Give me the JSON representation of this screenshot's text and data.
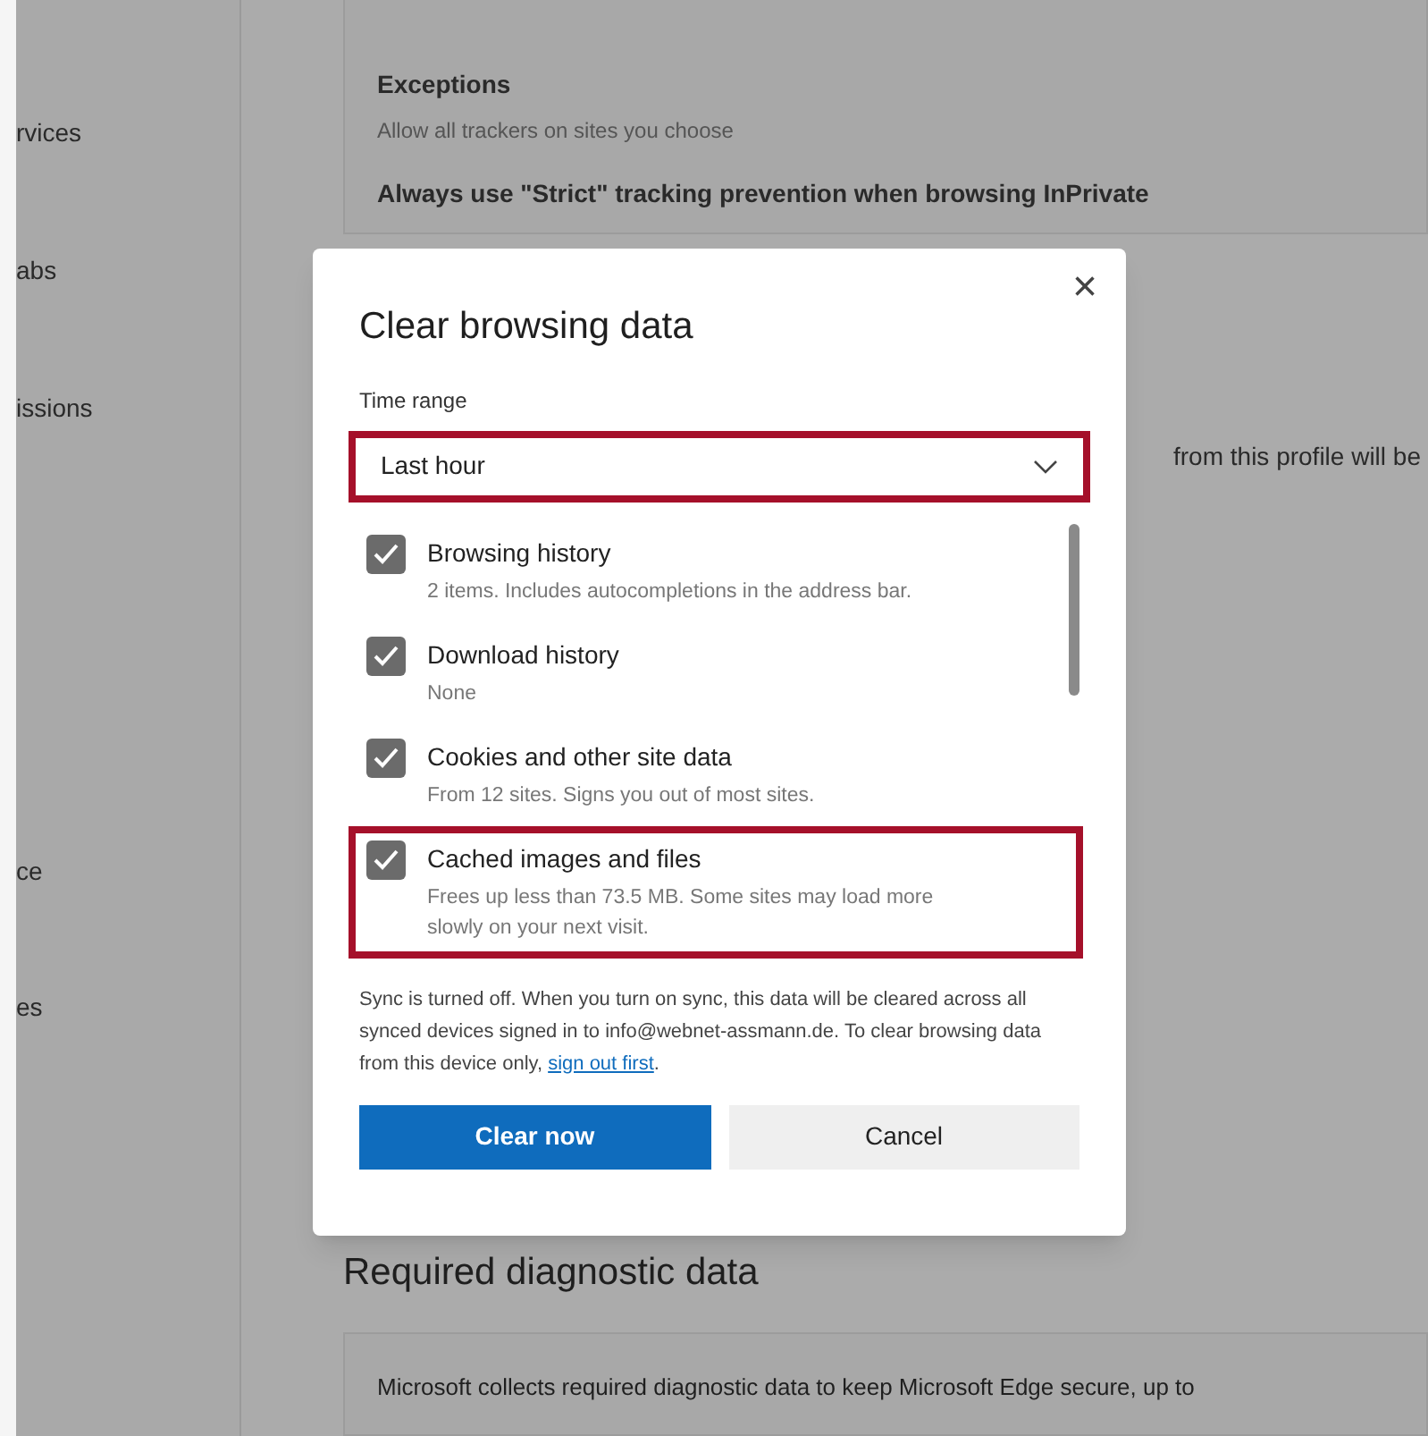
{
  "sidebar": {
    "items": [
      {
        "label": "rvices"
      },
      {
        "label": "abs"
      },
      {
        "label": "issions"
      },
      {
        "label": "ce"
      },
      {
        "label": "es"
      }
    ]
  },
  "background": {
    "exceptions_title": "Exceptions",
    "exceptions_text": "Allow all trackers on sites you choose",
    "strict_label": "Always use \"Strict\" tracking prevention when browsing InPrivate",
    "profile_text": "from this profile will be",
    "diagnostic_heading": "Required diagnostic data",
    "diagnostic_text": "Microsoft collects required diagnostic data to keep Microsoft Edge secure, up to"
  },
  "dialog": {
    "title": "Clear browsing data",
    "close": "×",
    "time_range": {
      "label": "Time range",
      "value": "Last hour",
      "highlighted": true
    },
    "items": [
      {
        "title": "Browsing history",
        "description": "2 items. Includes autocompletions in the address bar.",
        "checked": true,
        "highlighted": false
      },
      {
        "title": "Download history",
        "description": "None",
        "checked": true,
        "highlighted": false
      },
      {
        "title": "Cookies and other site data",
        "description": "From 12 sites. Signs you out of most sites.",
        "checked": true,
        "highlighted": false
      },
      {
        "title": "Cached images and files",
        "description": "Frees up less than 73.5 MB. Some sites may load more slowly on your next visit.",
        "checked": true,
        "highlighted": true
      }
    ],
    "sync_text": "Sync is turned off. When you turn on sync, this data will be cleared across all synced devices signed in to info@webnet-assmann.de. To clear browsing data from this device only,",
    "sync_link": "sign out first",
    "sync_end": ".",
    "buttons": [
      {
        "label": "Clear now",
        "kind": "primary"
      },
      {
        "label": "Cancel",
        "kind": "secondary"
      }
    ]
  }
}
